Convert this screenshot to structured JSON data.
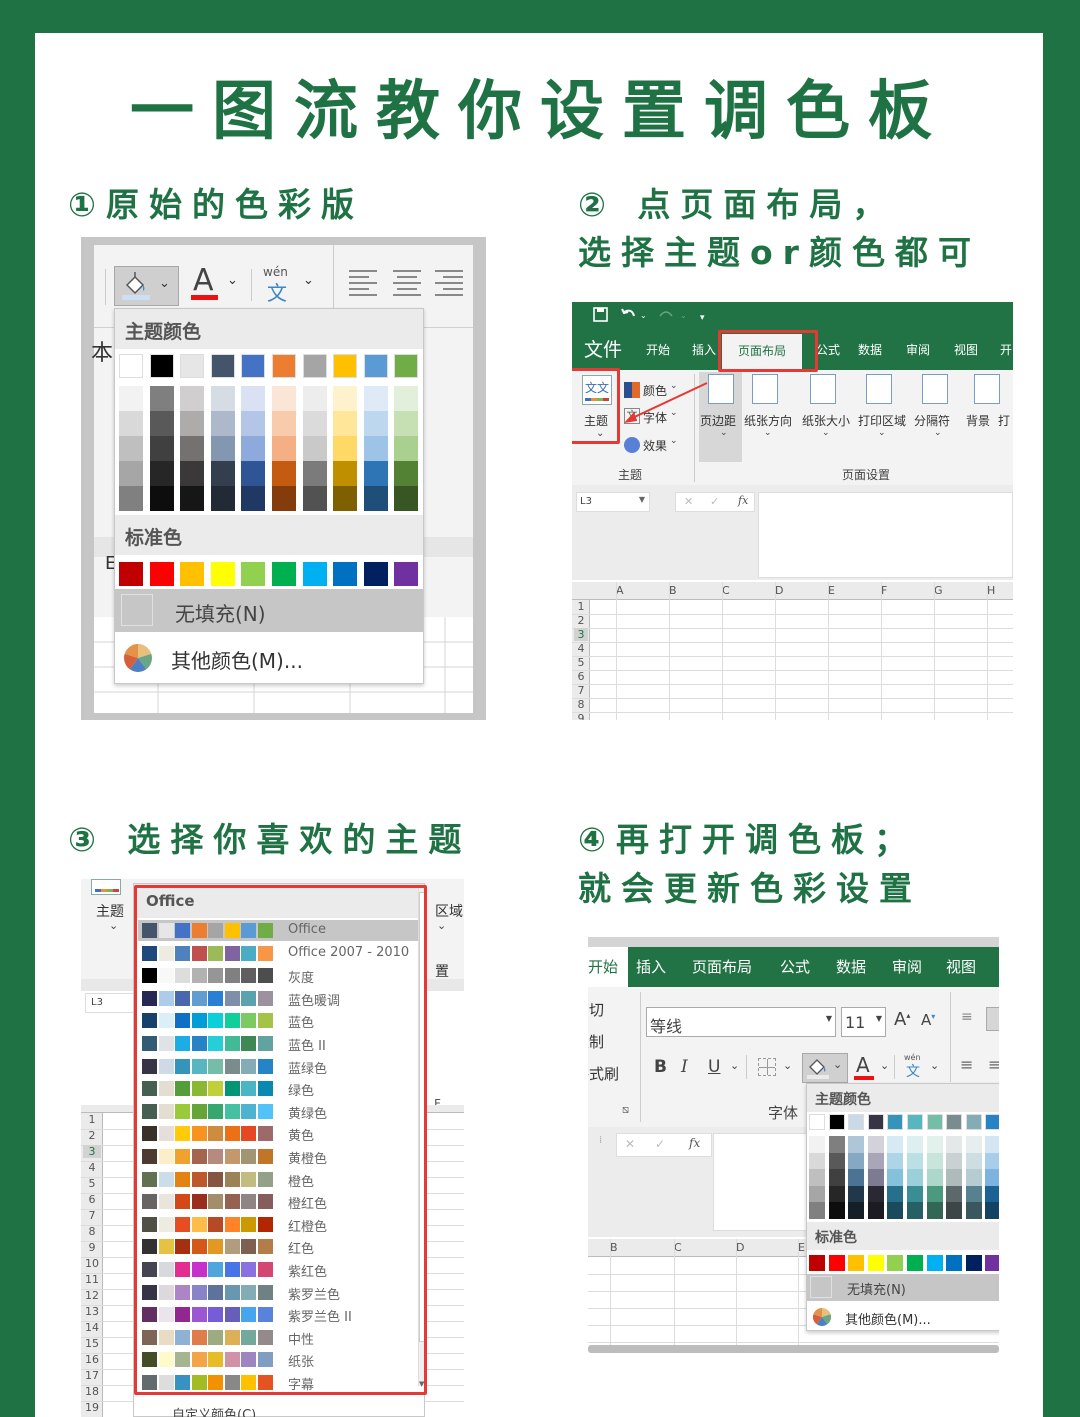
{
  "title": "一图流教你设置调色板",
  "steps": {
    "s1": "①原始的色彩版",
    "s2_line1": "② 点页面布局，",
    "s2_line2": "选择主题or颜色都可",
    "s3": "③ 选择你喜欢的主题",
    "s4_line1": "④再打开调色板；",
    "s4_line2": "就会更新色彩设置"
  },
  "palette1": {
    "theme_header": "主题颜色",
    "standard_header": "标准色",
    "no_fill": "无填充(N)",
    "more_colors": "其他颜色(M)...",
    "wen_label": "wén",
    "wen_char": "文",
    "side_char": "本",
    "row_label": "E",
    "theme_top": [
      "#ffffff",
      "#000000",
      "#e7e6e6",
      "#44546a",
      "#4472c4",
      "#ed7d31",
      "#a5a5a5",
      "#ffc000",
      "#5b9bd5",
      "#70ad47"
    ],
    "theme_shades": [
      [
        "#f2f2f2",
        "#d9d9d9",
        "#bfbfbf",
        "#a6a6a6",
        "#808080"
      ],
      [
        "#7f7f7f",
        "#595959",
        "#404040",
        "#262626",
        "#0d0d0d"
      ],
      [
        "#d0cece",
        "#aeabab",
        "#757171",
        "#3a3838",
        "#171616"
      ],
      [
        "#d6dce4",
        "#adb9ca",
        "#8497b0",
        "#333f4f",
        "#222b35"
      ],
      [
        "#d9e1f2",
        "#b4c6e7",
        "#8ea9db",
        "#2f5597",
        "#203864"
      ],
      [
        "#fbe5d6",
        "#f8cbad",
        "#f4b084",
        "#c55a11",
        "#843c0c"
      ],
      [
        "#ededed",
        "#dbdbdb",
        "#c9c9c9",
        "#7b7b7b",
        "#525252"
      ],
      [
        "#fff2cc",
        "#ffe699",
        "#ffd966",
        "#bf8f00",
        "#7f6000"
      ],
      [
        "#deebf7",
        "#bdd7ee",
        "#9dc3e6",
        "#2e75b6",
        "#1f4e79"
      ],
      [
        "#e2efda",
        "#c6e0b4",
        "#a9d08e",
        "#548235",
        "#375623"
      ]
    ],
    "standard": [
      "#c00000",
      "#ff0000",
      "#ffc000",
      "#ffff00",
      "#92d050",
      "#00b050",
      "#00b0f0",
      "#0070c0",
      "#002060",
      "#7030a0"
    ]
  },
  "ribbon2": {
    "tabs": [
      "文件",
      "开始",
      "插入",
      "页面布局",
      "公式",
      "数据",
      "审阅",
      "视图",
      "开"
    ],
    "active_tab": "页面布局",
    "theme_btn": "主题",
    "colors": "颜色",
    "fonts": "字体",
    "effects": "效果",
    "theme_group": "主题",
    "page_buttons": [
      "页边距",
      "纸张方向",
      "纸张大小",
      "打印区域",
      "分隔符",
      "背景",
      "打"
    ],
    "page_group": "页面设置",
    "name_box": "L3",
    "columns": [
      "A",
      "B",
      "C",
      "D",
      "E",
      "F",
      "G",
      "H"
    ],
    "rows": [
      "1",
      "2",
      "3",
      "4",
      "5",
      "6",
      "7",
      "8",
      "9"
    ],
    "theme_icon_text": "文文"
  },
  "themes3": {
    "header": "Office",
    "side_label": "主题",
    "right_label1": "区域",
    "right_label2": "置",
    "col_label": "F",
    "name_box": "L3",
    "custom_colors": "自定义颜色(C)...",
    "rows": [
      "1",
      "2",
      "3",
      "4",
      "5",
      "6",
      "7",
      "8",
      "9",
      "10",
      "11",
      "12",
      "13",
      "14",
      "15",
      "16",
      "17",
      "18",
      "19"
    ],
    "items": [
      {
        "name": "Office",
        "colors": [
          "#44546a",
          "#e7e6e6",
          "#4472c4",
          "#ed7d31",
          "#a5a5a5",
          "#ffc000",
          "#5b9bd5",
          "#70ad47"
        ]
      },
      {
        "name": "Office 2007 - 2010",
        "colors": [
          "#1f497d",
          "#eeece1",
          "#4f81bd",
          "#c0504d",
          "#9bbb59",
          "#8064a2",
          "#4bacc6",
          "#f79646"
        ]
      },
      {
        "name": "灰度",
        "colors": [
          "#000000",
          "#f8f8f8",
          "#dddddd",
          "#b2b2b2",
          "#969696",
          "#808080",
          "#5f5f5f",
          "#4d4d4d"
        ]
      },
      {
        "name": "蓝色暖调",
        "colors": [
          "#242852",
          "#acccea",
          "#4a66ac",
          "#629dd1",
          "#297fd5",
          "#7f8fa9",
          "#5aa2ae",
          "#9d90a0"
        ]
      },
      {
        "name": "蓝色",
        "colors": [
          "#17406d",
          "#dbeff9",
          "#0f6fc6",
          "#009dd9",
          "#0bd0d9",
          "#10cf9b",
          "#7cca62",
          "#a5c249"
        ]
      },
      {
        "name": "蓝色 II",
        "colors": [
          "#335b74",
          "#dfe3e5",
          "#1cade4",
          "#2683c6",
          "#27ced7",
          "#42ba97",
          "#3e8853",
          "#62a39f"
        ]
      },
      {
        "name": "蓝绿色",
        "colors": [
          "#373545",
          "#cedbe6",
          "#3494ba",
          "#58b6c0",
          "#75bda7",
          "#7a8c8e",
          "#84acb6",
          "#2683c6"
        ]
      },
      {
        "name": "绿色",
        "colors": [
          "#455f51",
          "#e3ded1",
          "#549e39",
          "#8ab833",
          "#c0cf3a",
          "#029676",
          "#4ab5c4",
          "#0989b1"
        ]
      },
      {
        "name": "黄绿色",
        "colors": [
          "#455f51",
          "#e3ded1",
          "#99cb38",
          "#63a537",
          "#37a76f",
          "#44c1a3",
          "#4eb3cf",
          "#51c3f9"
        ]
      },
      {
        "name": "黄色",
        "colors": [
          "#39302a",
          "#e5dedb",
          "#ffca08",
          "#f8931d",
          "#ce8d3e",
          "#ec7016",
          "#e64823",
          "#9c6a6a"
        ]
      },
      {
        "name": "黄橙色",
        "colors": [
          "#4e3b30",
          "#fbeec9",
          "#f0a22e",
          "#a5644e",
          "#b58b80",
          "#c3986d",
          "#a19574",
          "#c17529"
        ]
      },
      {
        "name": "橙色",
        "colors": [
          "#637052",
          "#ccddea",
          "#e48312",
          "#bd582c",
          "#865640",
          "#9b8357",
          "#c2bc80",
          "#94a088"
        ]
      },
      {
        "name": "橙红色",
        "colors": [
          "#696464",
          "#e9e5dc",
          "#d34817",
          "#9b2d1f",
          "#a28e6a",
          "#956251",
          "#918485",
          "#855d5d"
        ]
      },
      {
        "name": "红橙色",
        "colors": [
          "#505046",
          "#eeece1",
          "#e84c22",
          "#ffbd47",
          "#b64926",
          "#ff8427",
          "#cc9900",
          "#b22600"
        ]
      },
      {
        "name": "红色",
        "colors": [
          "#323232",
          "#e5c243",
          "#a5300f",
          "#d55816",
          "#e19825",
          "#b19c7d",
          "#7f5f52",
          "#b27d49"
        ]
      },
      {
        "name": "紫红色",
        "colors": [
          "#454551",
          "#d8d9dc",
          "#e32d91",
          "#c830cc",
          "#4ea6dc",
          "#4775e7",
          "#8971e1",
          "#d54773"
        ]
      },
      {
        "name": "紫罗兰色",
        "colors": [
          "#373545",
          "#dcd8dc",
          "#ad84c6",
          "#8784c7",
          "#5d739a",
          "#6997af",
          "#84acb6",
          "#6f8183"
        ]
      },
      {
        "name": "紫罗兰色 II",
        "colors": [
          "#632e62",
          "#eae5eb",
          "#92278f",
          "#9b57d3",
          "#755dd9",
          "#665eb8",
          "#45a5ed",
          "#5982db"
        ]
      },
      {
        "name": "中性",
        "colors": [
          "#7f6556",
          "#e8dcc4",
          "#8fb1d4",
          "#e07c49",
          "#9cab80",
          "#ddaf56",
          "#73a89c",
          "#948a8a"
        ]
      },
      {
        "name": "纸张",
        "colors": [
          "#444d26",
          "#fefac9",
          "#a5b592",
          "#f3a447",
          "#e7bc29",
          "#d092a7",
          "#9c85c0",
          "#809ec2"
        ]
      },
      {
        "name": "字幕",
        "colors": [
          "#646b6e",
          "#dddddd",
          "#3891c1",
          "#a4bc23",
          "#f39200",
          "#888888",
          "#ffc000",
          "#e55323"
        ]
      }
    ]
  },
  "ribbon4": {
    "tabs": [
      "开始",
      "插入",
      "页面布局",
      "公式",
      "数据",
      "审阅",
      "视图"
    ],
    "clip_items": [
      "剪切",
      "复制",
      "格式刷"
    ],
    "font_name": "等线",
    "font_size": "11",
    "grow": "A",
    "shrink": "A",
    "bold": "B",
    "italic": "I",
    "underline": "U",
    "font_group": "字体",
    "wen_label": "wén",
    "wen_char": "文",
    "theme_header": "主题颜色",
    "standard_header": "标准色",
    "no_fill": "无填充(N)",
    "more_colors": "其他颜色(M)...",
    "columns": [
      "B",
      "C",
      "D",
      "E"
    ],
    "theme_top": [
      "#ffffff",
      "#000000",
      "#c9dae6",
      "#373545",
      "#3494ba",
      "#58b6c0",
      "#75bda7",
      "#7a8c8e",
      "#84acb6",
      "#2683c6"
    ],
    "theme_shades": [
      [
        "#f2f2f2",
        "#d9d9d9",
        "#bfbfbf",
        "#a6a6a6",
        "#808080"
      ],
      [
        "#7f7f7f",
        "#595959",
        "#404040",
        "#262626",
        "#0d0d0d"
      ],
      [
        "#aec6d8",
        "#86a8c2",
        "#4c7393",
        "#21384a",
        "#151f28"
      ],
      [
        "#d3d2db",
        "#a8a6b8",
        "#7d7a94",
        "#292833",
        "#1c1b22"
      ],
      [
        "#d6eaf3",
        "#add5e7",
        "#84c1dc",
        "#27708c",
        "#1a4b5d"
      ],
      [
        "#deeff2",
        "#bcdfe6",
        "#9bcfd9",
        "#3a8c95",
        "#276064"
      ],
      [
        "#e3f1ed",
        "#c8e5dc",
        "#acd7ca",
        "#4b9a7f",
        "#336755"
      ],
      [
        "#e4e8e8",
        "#c9d1d2",
        "#afbabb",
        "#5b696a",
        "#3d4647"
      ],
      [
        "#e6eef0",
        "#cddde1",
        "#b5ccd3",
        "#568290",
        "#3a5760"
      ],
      [
        "#d4e6f4",
        "#a8cdea",
        "#7cb4df",
        "#1c6294",
        "#134262"
      ]
    ],
    "standard": [
      "#c00000",
      "#ff0000",
      "#ffc000",
      "#ffff00",
      "#92d050",
      "#00b050",
      "#00b0f0",
      "#0070c0",
      "#002060",
      "#7030a0"
    ]
  }
}
